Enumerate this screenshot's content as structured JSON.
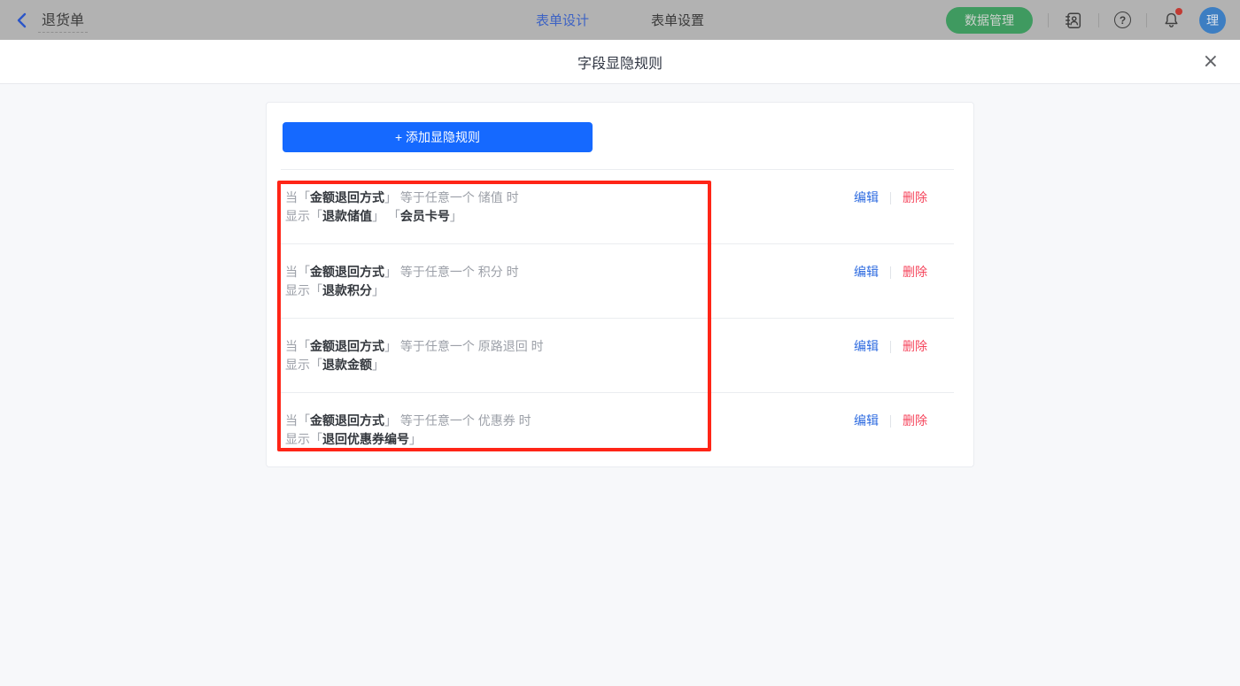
{
  "topbar": {
    "back_title": "退货单",
    "tabs": {
      "design": "表单设计",
      "settings": "表单设置"
    },
    "data_manage": "数据管理",
    "avatar": "理",
    "icons": {
      "back": "chevron-left",
      "contacts": "address-book",
      "help": "question-circle",
      "help_glyph": "?",
      "notifications": "bell-with-badge"
    }
  },
  "modal": {
    "title": "字段显隐规则",
    "close": "×"
  },
  "rules_panel": {
    "add_button": "+ 添加显隐规则",
    "actions": {
      "edit": "编辑",
      "delete": "删除"
    },
    "rules": [
      {
        "line1": {
          "pre": "当「",
          "field": "金额退回方式",
          "post": "」 等于任意一个 储值 时"
        },
        "line2": {
          "pre": "显示「",
          "field1": "退款储值",
          "mid": "」 「",
          "field2": "会员卡号",
          "post": "」"
        }
      },
      {
        "line1": {
          "pre": "当「",
          "field": "金额退回方式",
          "post": "」 等于任意一个 积分 时"
        },
        "line2": {
          "pre": "显示「",
          "field1": "退款积分",
          "post": "」"
        }
      },
      {
        "line1": {
          "pre": "当「",
          "field": "金额退回方式",
          "post": "」 等于任意一个 原路退回 时"
        },
        "line2": {
          "pre": "显示「",
          "field1": "退款金额",
          "post": "」"
        }
      },
      {
        "line1": {
          "pre": "当「",
          "field": "金额退回方式",
          "post": "」 等于任意一个 优惠券 时"
        },
        "line2": {
          "pre": "显示「",
          "field1": "退回优惠券编号",
          "post": "」"
        }
      }
    ]
  },
  "colors": {
    "primary_blue": "#1569ff",
    "link_blue": "#2e6be0",
    "danger_red": "#f5455c",
    "annotation_red": "#ff2517",
    "brand_green_dimmed": "#3f9a60",
    "avatar_blue_dimmed": "#3d7ec2",
    "topbar_dim": "#b2b2b2"
  }
}
